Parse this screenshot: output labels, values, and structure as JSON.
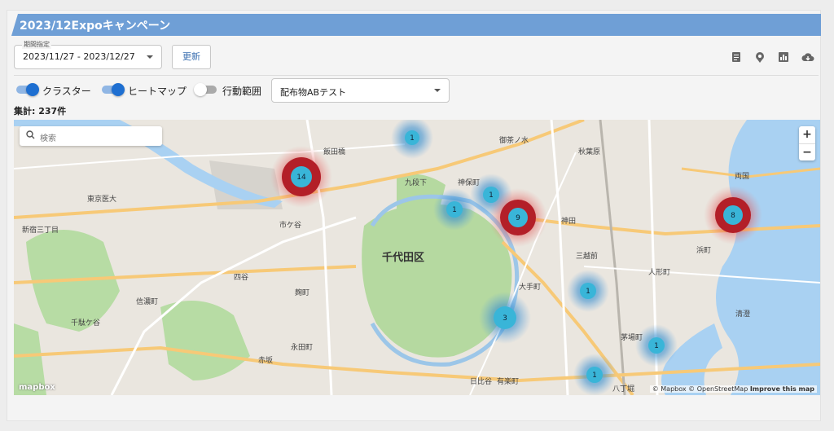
{
  "title": "2023/12Expoキャンペーン",
  "period": {
    "legend": "期間指定",
    "value": "2023/11/27 - 2023/12/27"
  },
  "update_label": "更新",
  "toolbar_icons": [
    "report-icon",
    "map-pin-icon",
    "chart-icon",
    "cloud-download-icon"
  ],
  "toggles": [
    {
      "label": "クラスター",
      "on": true
    },
    {
      "label": "ヒートマップ",
      "on": true
    },
    {
      "label": "行動範囲",
      "on": false
    }
  ],
  "material_select": {
    "value": "配布物ABテスト"
  },
  "total": "集計: 237件",
  "map": {
    "search_placeholder": "検索",
    "zoom_in": "+",
    "zoom_out": "−",
    "logo": "mapbox",
    "attribution": "© Mapbox © OpenStreetMap",
    "improve": "Improve this map",
    "labels": {
      "chiyoda": "千代田区",
      "ichigaya": "市ケ谷",
      "kudanshita": "九段下",
      "jimbocho": "神保町",
      "ochanomizu": "御茶ノ水",
      "akihabara": "秋葉原",
      "kanda": "神田",
      "otemachi": "大手町",
      "tokyo_med": "東京医大",
      "shinjuku_3": "新宿三丁目",
      "yotsuya": "四谷",
      "nagatacho": "永田町",
      "hibiya": "日比谷",
      "yurakucho": "有楽町",
      "hatchobori": "八丁堀",
      "ningyocho": "人形町",
      "hamacho": "浜町",
      "ryogoku": "両国",
      "kiyosumi": "清澄",
      "akasaka": "赤坂",
      "iidabashi": "飯田橋",
      "kojimachi": "麹町",
      "sendagaya": "千駄ケ谷",
      "shinanomachi": "信濃町",
      "mitsukoshimae": "三越前",
      "kayabacho": "茅場町"
    },
    "clusters": [
      {
        "count": "1",
        "style": "blue"
      },
      {
        "count": "14",
        "style": "red"
      },
      {
        "count": "1",
        "style": "blue"
      },
      {
        "count": "1",
        "style": "blue"
      },
      {
        "count": "9",
        "style": "red"
      },
      {
        "count": "3",
        "style": "blue"
      },
      {
        "count": "1",
        "style": "blue"
      },
      {
        "count": "1",
        "style": "blue"
      },
      {
        "count": "1",
        "style": "blue"
      },
      {
        "count": "8",
        "style": "red"
      }
    ]
  }
}
